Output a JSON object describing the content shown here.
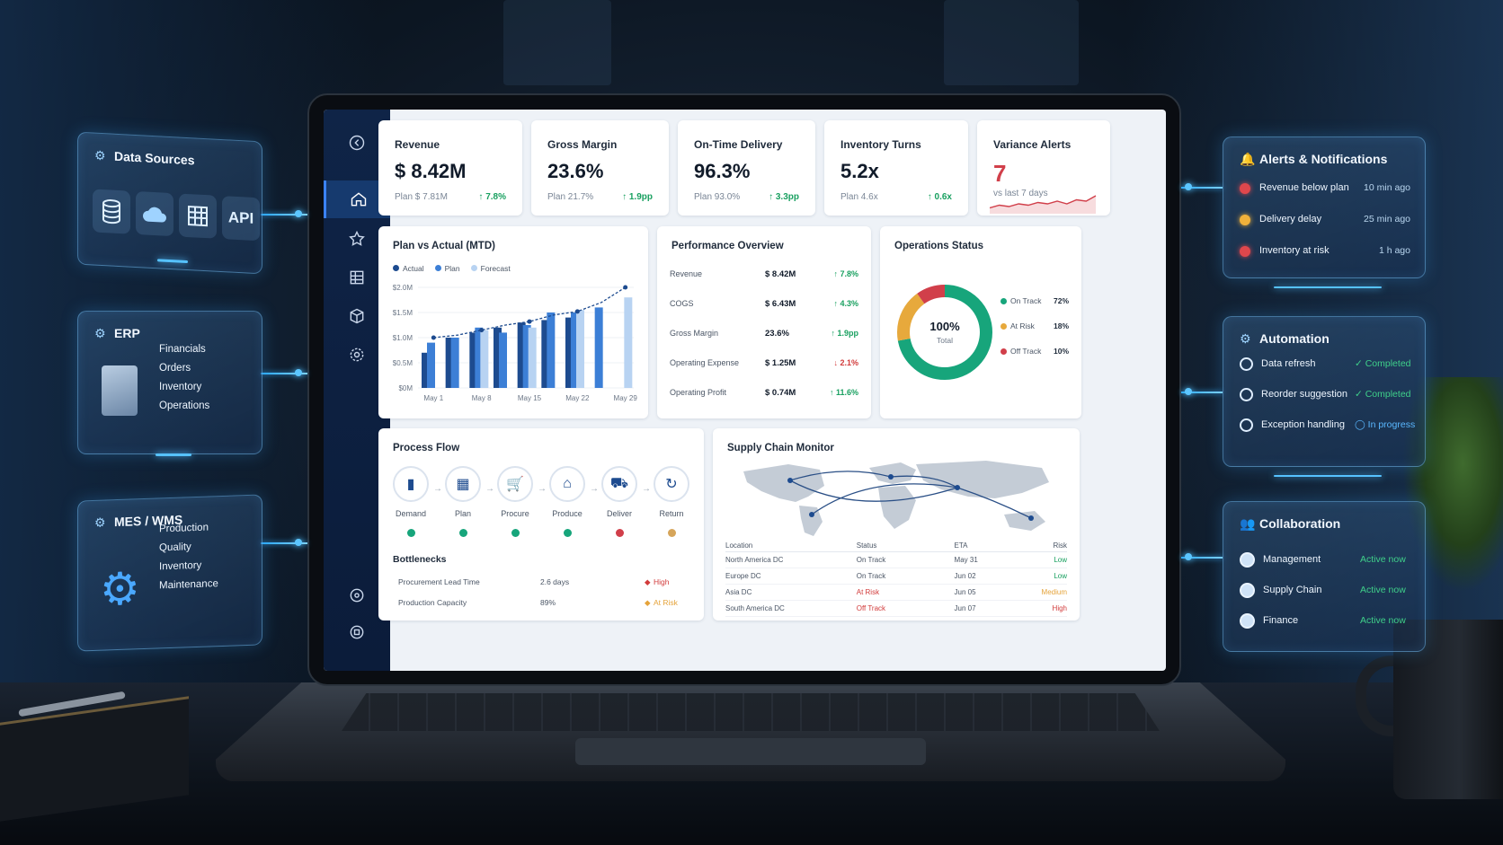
{
  "sidebar": {
    "items": [
      "back-icon",
      "home-icon",
      "star-icon",
      "grid-icon",
      "cube-icon",
      "settings-icon",
      "circle-icon",
      "circle-icon"
    ]
  },
  "kpis": [
    {
      "title": "Revenue",
      "value": "$ 8.42M",
      "plan": "Plan $ 7.81M",
      "delta": "↑ 7.8%"
    },
    {
      "title": "Gross Margin",
      "value": "23.6%",
      "plan": "Plan 21.7%",
      "delta": "↑ 1.9pp"
    },
    {
      "title": "On-Time Delivery",
      "value": "96.3%",
      "plan": "Plan 93.0%",
      "delta": "↑ 3.3pp"
    },
    {
      "title": "Inventory Turns",
      "value": "5.2x",
      "plan": "Plan 4.6x",
      "delta": "↑ 0.6x"
    }
  ],
  "variance": {
    "title": "Variance Alerts",
    "value": "7",
    "sub": "vs last 7 days",
    "spark": [
      3,
      5,
      4,
      6,
      5,
      7,
      6,
      8,
      6,
      9,
      8,
      12
    ]
  },
  "plan_vs_actual": {
    "title": "Plan vs Actual (MTD)",
    "legend": [
      "Actual",
      "Plan",
      "Forecast"
    ]
  },
  "chart_data": {
    "type": "bar",
    "title": "Plan vs Actual (MTD)",
    "categories": [
      "May 1",
      "",
      "May 8",
      "",
      "May 15",
      "",
      "May 22",
      "",
      "May 29"
    ],
    "yticks": [
      "$0M",
      "$0.5M",
      "$1.0M",
      "$1.5M",
      "$2.0M"
    ],
    "ylim": [
      0,
      2.0
    ],
    "series": [
      {
        "name": "Actual",
        "values": [
          0.7,
          1.0,
          1.1,
          1.2,
          1.3,
          1.35,
          1.4,
          null,
          null
        ]
      },
      {
        "name": "Plan",
        "values": [
          0.9,
          1.0,
          1.2,
          1.1,
          1.25,
          1.5,
          1.5,
          1.6,
          null
        ]
      },
      {
        "name": "Forecast",
        "values": [
          null,
          null,
          1.15,
          null,
          1.2,
          null,
          1.55,
          null,
          1.8
        ]
      }
    ],
    "line": {
      "name": "Actual trend",
      "values": [
        1.0,
        1.05,
        1.15,
        1.25,
        1.32,
        1.45,
        1.52,
        1.7,
        2.0
      ]
    },
    "legend": "top-left"
  },
  "performance": {
    "title": "Performance Overview",
    "rows": [
      {
        "label": "Revenue",
        "value": "$ 8.42M",
        "delta": "↑ 7.8%",
        "dir": "pos"
      },
      {
        "label": "COGS",
        "value": "$ 6.43M",
        "delta": "↑ 4.3%",
        "dir": "pos"
      },
      {
        "label": "Gross Margin",
        "value": "23.6%",
        "delta": "↑ 1.9pp",
        "dir": "pos"
      },
      {
        "label": "Operating Expense",
        "value": "$ 1.25M",
        "delta": "↓ 2.1%",
        "dir": "neg"
      },
      {
        "label": "Operating Profit",
        "value": "$ 0.74M",
        "delta": "↑ 11.6%",
        "dir": "pos"
      }
    ]
  },
  "ops_status": {
    "title": "Operations Status",
    "center_value": "100%",
    "center_label": "Total",
    "segments": [
      {
        "label": "On Track",
        "pct": "72%",
        "value": 72,
        "color": "#17a57b"
      },
      {
        "label": "At Risk",
        "pct": "18%",
        "value": 18,
        "color": "#e7a93c"
      },
      {
        "label": "Off Track",
        "pct": "10%",
        "value": 10,
        "color": "#d13f4a"
      }
    ]
  },
  "process_flow": {
    "title": "Process Flow",
    "steps": [
      {
        "label": "Demand",
        "icon": "bar-chart-icon",
        "glyph": "▮",
        "status": "#17a57b"
      },
      {
        "label": "Plan",
        "icon": "calendar-icon",
        "glyph": "▦",
        "status": "#17a57b"
      },
      {
        "label": "Procure",
        "icon": "cart-icon",
        "glyph": "🛒",
        "status": "#17a57b"
      },
      {
        "label": "Produce",
        "icon": "factory-icon",
        "glyph": "⌂",
        "status": "#17a57b"
      },
      {
        "label": "Deliver",
        "icon": "truck-icon",
        "glyph": "⛟",
        "status": "#d13f4a"
      },
      {
        "label": "Return",
        "icon": "refresh-icon",
        "glyph": "↻",
        "status": "#d6a55a"
      }
    ],
    "bottlenecks_title": "Bottlenecks",
    "bottlenecks": [
      {
        "label": "Procurement Lead Time",
        "value": "2.6 days",
        "level": "High",
        "cls": "neg"
      },
      {
        "label": "Production Capacity",
        "value": "89%",
        "level": "At Risk",
        "cls": "amber"
      }
    ]
  },
  "supply_chain": {
    "title": "Supply Chain Monitor",
    "headers": [
      "Location",
      "Status",
      "ETA",
      "Risk"
    ],
    "rows": [
      {
        "location": "North America DC",
        "status": "On Track",
        "eta": "May 31",
        "risk": "Low",
        "scls": "",
        "rcls": "pos"
      },
      {
        "location": "Europe DC",
        "status": "On Track",
        "eta": "Jun 02",
        "risk": "Low",
        "scls": "",
        "rcls": "pos"
      },
      {
        "location": "Asia DC",
        "status": "At Risk",
        "eta": "Jun 05",
        "risk": "Medium",
        "scls": "neg",
        "rcls": "amber"
      },
      {
        "location": "South America DC",
        "status": "Off Track",
        "eta": "Jun 07",
        "risk": "High",
        "scls": "neg",
        "rcls": "neg"
      }
    ]
  },
  "data_sources": {
    "title": "Data Sources",
    "tiles": [
      "database-icon",
      "cloud-icon",
      "table-icon"
    ],
    "api_label": "API"
  },
  "erp": {
    "title": "ERP",
    "items": [
      "Financials",
      "Orders",
      "Inventory",
      "Operations"
    ]
  },
  "mes": {
    "title": "MES / WMS",
    "items": [
      "Production",
      "Quality",
      "Inventory",
      "Maintenance"
    ]
  },
  "alerts": {
    "title": "Alerts & Notifications",
    "items": [
      {
        "label": "Revenue below plan",
        "time": "10 min ago",
        "color": "#e0474c"
      },
      {
        "label": "Delivery delay",
        "time": "25 min ago",
        "color": "#f0b13b"
      },
      {
        "label": "Inventory at risk",
        "time": "1 h ago",
        "color": "#e0474c"
      }
    ]
  },
  "automation": {
    "title": "Automation",
    "items": [
      {
        "label": "Data refresh",
        "status": "✓ Completed",
        "color": "#3fd08a"
      },
      {
        "label": "Reorder suggestion",
        "status": "✓ Completed",
        "color": "#3fd08a"
      },
      {
        "label": "Exception handling",
        "status": "◯ In progress",
        "color": "#5ab8ff"
      }
    ]
  },
  "collaboration": {
    "title": "Collaboration",
    "items": [
      {
        "label": "Management",
        "status": "Active now"
      },
      {
        "label": "Supply Chain",
        "status": "Active now"
      },
      {
        "label": "Finance",
        "status": "Active now"
      }
    ]
  }
}
